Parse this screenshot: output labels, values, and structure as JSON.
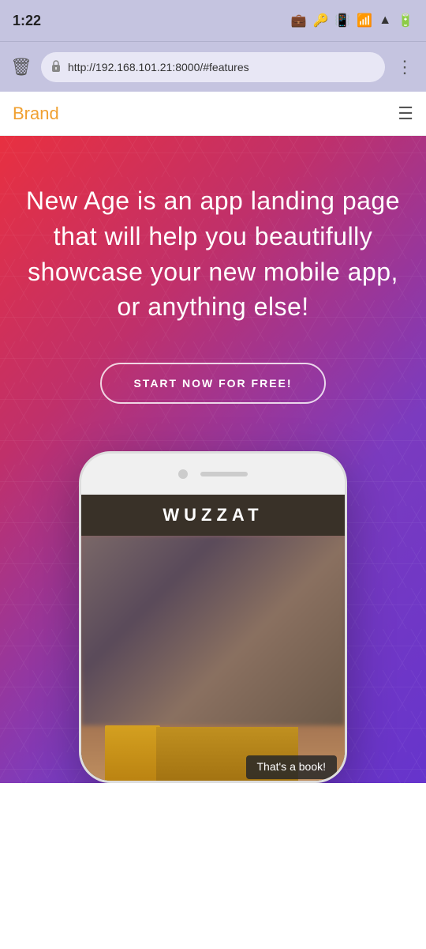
{
  "statusBar": {
    "time": "1:22",
    "icons": [
      "briefcase",
      "key",
      "vibrate",
      "wifi",
      "signal",
      "battery"
    ]
  },
  "browserBar": {
    "url": "http://192.168.101.21:8000/#features",
    "menuIcon": "⋮"
  },
  "nav": {
    "brand": "Brand",
    "menuIcon": "☰"
  },
  "hero": {
    "title": "New Age is an app landing page that will help you beautifully showcase your new mobile app, or anything else!",
    "ctaLabel": "START NOW FOR FREE!"
  },
  "phoneApp": {
    "appTitle": "WUZZAT",
    "captionText": "That's a book!"
  },
  "bottomBar": {
    "icons": [
      "←",
      "→",
      "☰"
    ]
  }
}
